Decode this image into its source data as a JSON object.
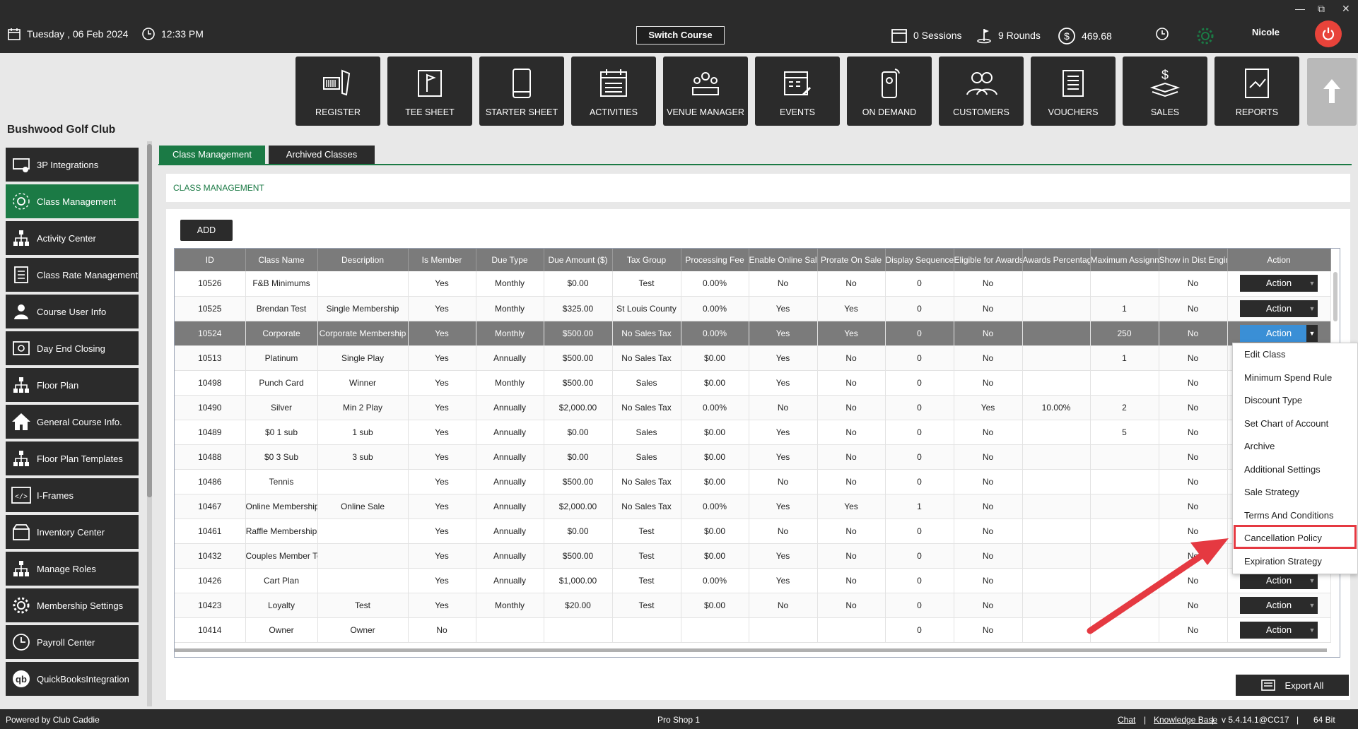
{
  "topbar": {
    "date": "Tuesday ,  06 Feb 2024",
    "time": "12:33 PM",
    "switch_course": "Switch Course",
    "sessions": "0 Sessions",
    "rounds": "9 Rounds",
    "balance": "469.68",
    "user": "Nicole"
  },
  "nav": [
    "REGISTER",
    "TEE SHEET",
    "STARTER SHEET",
    "ACTIVITIES",
    "VENUE MANAGER",
    "EVENTS",
    "ON DEMAND",
    "CUSTOMERS",
    "VOUCHERS",
    "SALES",
    "REPORTS"
  ],
  "club_name": "Bushwood Golf Club",
  "sidebar": [
    {
      "label": "3P Integrations",
      "icon": "api-icon"
    },
    {
      "label": "Class Management",
      "icon": "class-management-icon"
    },
    {
      "label": "Activity  Center",
      "icon": "activity-center-icon"
    },
    {
      "label": "Class Rate Management",
      "icon": "class-rate-icon"
    },
    {
      "label": "Course User Info",
      "icon": "user-info-icon"
    },
    {
      "label": "Day End Closing",
      "icon": "day-end-icon"
    },
    {
      "label": "Floor Plan",
      "icon": "floor-plan-icon"
    },
    {
      "label": "General Course Info.",
      "icon": "home-icon"
    },
    {
      "label": "Floor Plan Templates",
      "icon": "floor-plan-templates-icon"
    },
    {
      "label": "I-Frames",
      "icon": "iframe-icon"
    },
    {
      "label": "Inventory Center",
      "icon": "inventory-icon"
    },
    {
      "label": "Manage Roles",
      "icon": "roles-icon"
    },
    {
      "label": "Membership Settings",
      "icon": "gear-icon"
    },
    {
      "label": "Payroll Center",
      "icon": "clock-icon"
    },
    {
      "label": "QuickBooksIntegration",
      "icon": "quickbooks-icon"
    }
  ],
  "tabs": [
    "Class Management",
    "Archived Classes"
  ],
  "section_title": "CLASS MANAGEMENT",
  "add_label": "ADD",
  "columns": [
    "ID",
    "Class Name",
    "Description",
    "Is Member",
    "Due Type",
    "Due Amount ($)",
    "Tax Group",
    "Processing Fee",
    "Enable Online Sale",
    "Prorate On Sale",
    "Display Sequence",
    "Eligible for Awards",
    "Awards Percentage",
    "Maximum Assignment",
    "Show in Dist Engine",
    "Action"
  ],
  "rows": [
    [
      "10526",
      "F&B Minimums",
      "",
      "Yes",
      "Monthly",
      "$0.00",
      "Test",
      "0.00%",
      "No",
      "No",
      "0",
      "No",
      "",
      "",
      "No",
      "Action"
    ],
    [
      "10525",
      "Brendan Test",
      "Single Membership",
      "Yes",
      "Monthly",
      "$325.00",
      "St Louis County",
      "0.00%",
      "Yes",
      "Yes",
      "0",
      "No",
      "",
      "1",
      "No",
      "Action"
    ],
    [
      "10524",
      "Corporate",
      "Corporate Membership",
      "Yes",
      "Monthly",
      "$500.00",
      "No Sales Tax",
      "0.00%",
      "Yes",
      "Yes",
      "0",
      "No",
      "",
      "250",
      "No",
      "Action"
    ],
    [
      "10513",
      "Platinum",
      "Single Play",
      "Yes",
      "Annually",
      "$500.00",
      "No Sales Tax",
      "$0.00",
      "Yes",
      "No",
      "0",
      "No",
      "",
      "1",
      "No",
      ""
    ],
    [
      "10498",
      "Punch Card",
      "Winner",
      "Yes",
      "Monthly",
      "$500.00",
      "Sales",
      "$0.00",
      "Yes",
      "No",
      "0",
      "No",
      "",
      "",
      "No",
      ""
    ],
    [
      "10490",
      "Silver",
      "Min 2 Play",
      "Yes",
      "Annually",
      "$2,000.00",
      "No Sales Tax",
      "0.00%",
      "No",
      "No",
      "0",
      "Yes",
      "10.00%",
      "2",
      "No",
      ""
    ],
    [
      "10489",
      "$0 1 sub",
      "1 sub",
      "Yes",
      "Annually",
      "$0.00",
      "Sales",
      "$0.00",
      "Yes",
      "No",
      "0",
      "No",
      "",
      "5",
      "No",
      ""
    ],
    [
      "10488",
      "$0 3 Sub",
      "3 sub",
      "Yes",
      "Annually",
      "$0.00",
      "Sales",
      "$0.00",
      "Yes",
      "No",
      "0",
      "No",
      "",
      "",
      "No",
      ""
    ],
    [
      "10486",
      "Tennis",
      "",
      "Yes",
      "Annually",
      "$500.00",
      "No Sales Tax",
      "$0.00",
      "No",
      "No",
      "0",
      "No",
      "",
      "",
      "No",
      ""
    ],
    [
      "10467",
      "Online Membership",
      "Online Sale",
      "Yes",
      "Annually",
      "$2,000.00",
      "No Sales Tax",
      "0.00%",
      "Yes",
      "Yes",
      "1",
      "No",
      "",
      "",
      "No",
      ""
    ],
    [
      "10461",
      "Raffle Membership",
      "",
      "Yes",
      "Annually",
      "$0.00",
      "Test",
      "$0.00",
      "No",
      "No",
      "0",
      "No",
      "",
      "",
      "No",
      ""
    ],
    [
      "10432",
      "Couples Member Test",
      "",
      "Yes",
      "Annually",
      "$500.00",
      "Test",
      "$0.00",
      "Yes",
      "No",
      "0",
      "No",
      "",
      "",
      "No",
      ""
    ],
    [
      "10426",
      "Cart Plan",
      "",
      "Yes",
      "Annually",
      "$1,000.00",
      "Test",
      "0.00%",
      "Yes",
      "No",
      "0",
      "No",
      "",
      "",
      "No",
      "Action"
    ],
    [
      "10423",
      "Loyalty",
      "Test",
      "Yes",
      "Monthly",
      "$20.00",
      "Test",
      "$0.00",
      "No",
      "No",
      "0",
      "No",
      "",
      "",
      "No",
      "Action"
    ],
    [
      "10414",
      "Owner",
      "Owner",
      "No",
      "",
      "",
      "",
      "",
      "",
      "",
      "0",
      "No",
      "",
      "",
      "No",
      "Action"
    ]
  ],
  "action_menu": [
    "Edit Class",
    "Minimum Spend Rule",
    "Discount Type",
    "Set Chart of Account",
    "Archive",
    "Additional Settings",
    "Sale Strategy",
    "Terms And Conditions",
    "Cancellation Policy",
    "Expiration Strategy"
  ],
  "export_label": "Export All",
  "footer": {
    "powered": "Powered by Club Caddie",
    "center": "Pro Shop 1",
    "chat": "Chat",
    "sep": "|",
    "kb": "Knowledge Base",
    "version": "v 5.4.14.1@CC17",
    "bits": "64 Bit"
  },
  "colors": {
    "accent": "#1b7a45",
    "dark": "#2b2b2b",
    "highlight": "#e53941",
    "selected_action": "#3a8fd6"
  }
}
